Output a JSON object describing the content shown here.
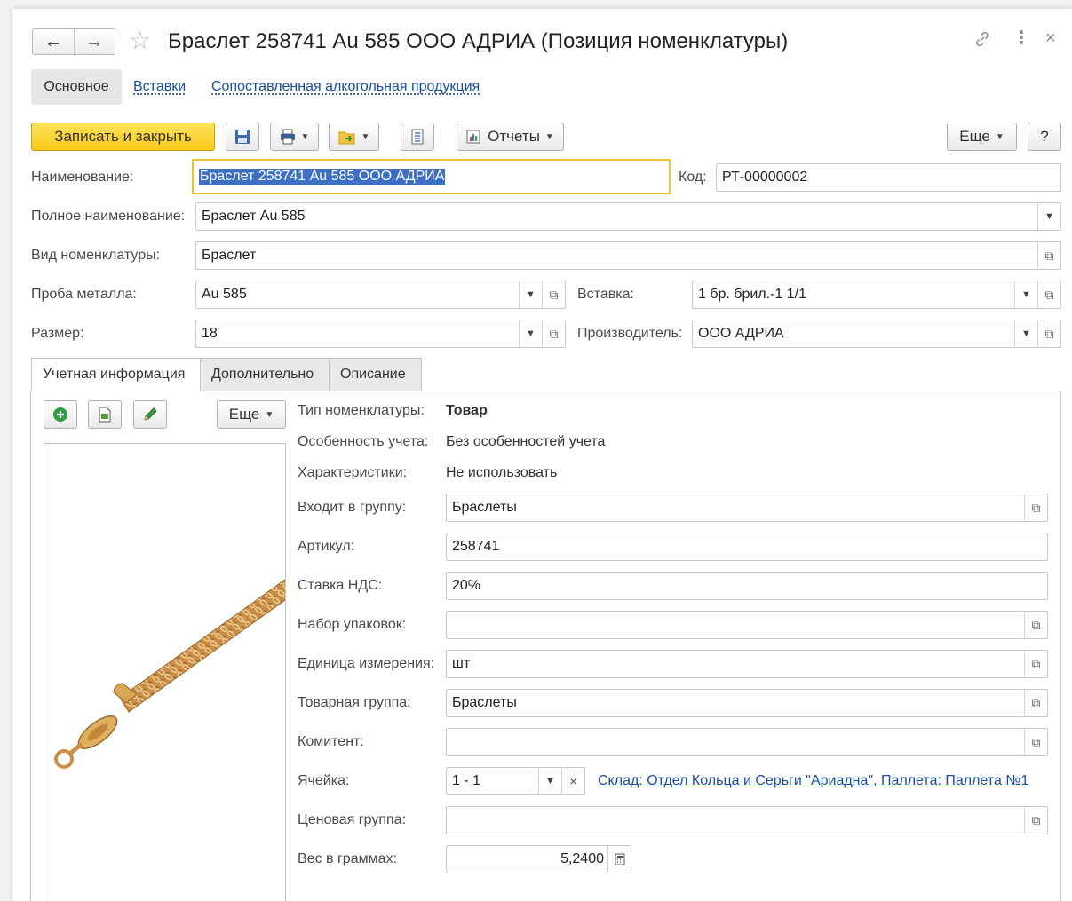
{
  "window": {
    "title": "Браслет 258741 Au 585 ООО АДРИА (Позиция номенклатуры)",
    "nav_back": "←",
    "nav_forward": "→"
  },
  "sections": {
    "main": "Основное",
    "inserts": "Вставки",
    "alcohol": "Сопоставленная алкогольная продукция"
  },
  "toolbar": {
    "save_close": "Записать и закрыть",
    "reports": "Отчеты",
    "more": "Еще",
    "help": "?"
  },
  "form": {
    "name_label": "Наименование:",
    "name_value": "Браслет 258741 Au 585 ООО АДРИА",
    "code_label": "Код:",
    "code_value": "РТ-00000002",
    "fullname_label": "Полное наименование:",
    "fullname_value": "Браслет Au 585",
    "kind_label": "Вид номенклатуры:",
    "kind_value": "Браслет",
    "probe_label": "Проба металла:",
    "probe_value": "Au 585",
    "insert_label": "Вставка:",
    "insert_value": "1 бр. брил.-1 1/1",
    "size_label": "Размер:",
    "size_value": "18",
    "maker_label": "Производитель:",
    "maker_value": "ООО АДРИА"
  },
  "tabs": [
    "Учетная информация",
    "Дополнительно",
    "Описание"
  ],
  "image_toolbar": {
    "more": "Еще"
  },
  "details": {
    "type_label": "Тип номенклатуры:",
    "type_value": "Товар",
    "accounting_label": "Особенность учета:",
    "accounting_value": "Без особенностей учета",
    "chars_label": "Характеристики:",
    "chars_value": "Не использовать",
    "group_label": "Входит в группу:",
    "group_value": "Браслеты",
    "article_label": "Артикул:",
    "article_value": "258741",
    "vat_label": "Ставка НДС:",
    "vat_value": "20%",
    "packs_label": "Набор упаковок:",
    "packs_value": "",
    "unit_label": "Единица измерения:",
    "unit_value": "шт",
    "goods_group_label": "Товарная группа:",
    "goods_group_value": "Браслеты",
    "consignor_label": "Комитент:",
    "consignor_value": "",
    "cell_label": "Ячейка:",
    "cell_value": "1 - 1",
    "cell_link": "Склад: Отдел Кольца и Серьги \"Ариадна\", Паллета: Паллета №1",
    "price_group_label": "Ценовая группа:",
    "price_group_value": "",
    "weight_label": "Вес в граммах:",
    "weight_value": "5,2400"
  }
}
